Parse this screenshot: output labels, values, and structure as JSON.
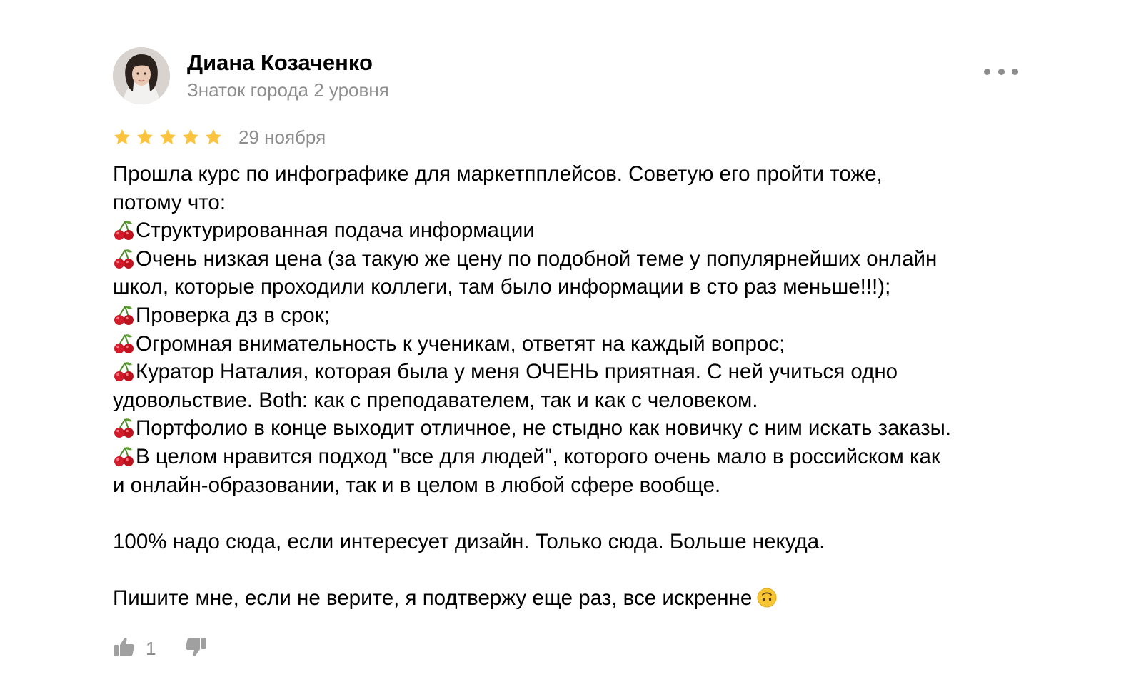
{
  "author": {
    "name": "Диана Козаченко",
    "level": "Знаток города 2 уровня"
  },
  "menu": {
    "icon": "more-dots-icon"
  },
  "rating": {
    "stars": 5,
    "max": 5,
    "date": "29 ноября",
    "star_color": "#fbc43c"
  },
  "review": {
    "lines": [
      "Прошла курс по инфографике для маркетпплейсов. Советую его пройти тоже,",
      "потому что:",
      "Структурированная подача информации",
      "Очень низкая цена (за такую же цену по подобной теме у популярнейших онлайн",
      "школ, которые проходили коллеги, там было информации в сто раз меньше!!!);",
      "Проверка дз в срок;",
      "Огромная внимательность к ученикам, ответят на каждый вопрос;",
      "Куратор Наталия, которая была у меня ОЧЕНЬ приятная. С ней учиться одно",
      "удовольствие. Both: как с преподавателем, так и как с человеком.",
      "Портфолио в конце выходит отличное, не стыдно как новичку с ним искать заказы.",
      "В целом нравится подход \"все для людей\", которого очень мало в российском как",
      "и онлайн-образовании, так и в целом в любой сфере вообще.",
      "100% надо сюда, если интересует дизайн. Только сюда. Больше некуда.",
      "Пишите мне, если не верите, я подтвержу еще раз, все искренне"
    ],
    "bullet_icon": "cherries-icon",
    "end_emoji_icon": "upside-down-face-icon"
  },
  "reactions": {
    "like_icon": "thumbs-up-icon",
    "like_count": "1",
    "dislike_icon": "thumbs-down-icon"
  },
  "colors": {
    "text": "#000000",
    "muted": "#8d8d8d",
    "icon": "#a0a0a0"
  }
}
